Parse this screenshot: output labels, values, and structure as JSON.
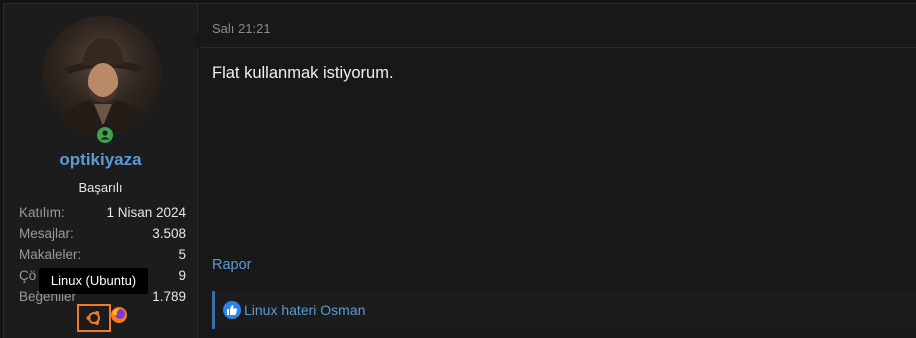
{
  "user": {
    "username": "optikiyaza",
    "title": "Başarılı",
    "status": "online",
    "stats": [
      {
        "label": "Katılım:",
        "value": "1 Nisan 2024"
      },
      {
        "label": "Mesajlar:",
        "value": "3.508"
      },
      {
        "label": "Makaleler:",
        "value": "5"
      },
      {
        "label": "Çö",
        "value": "9"
      },
      {
        "label": "Beğeniler",
        "value": "1.789"
      }
    ],
    "tooltip": "Linux (Ubuntu)",
    "os_icon": "ubuntu-icon",
    "browser_icon": "firefox-icon"
  },
  "post": {
    "time": "Salı 21:21",
    "message": "Flat kullanmak istiyorum.",
    "report_label": "Rapor",
    "reaction_icon": "like-icon",
    "reaction_text": "Linux hateri Osman"
  },
  "colors": {
    "accent": "#5c9ad6",
    "online": "#3fa34d",
    "highlight": "#f07a2a"
  }
}
